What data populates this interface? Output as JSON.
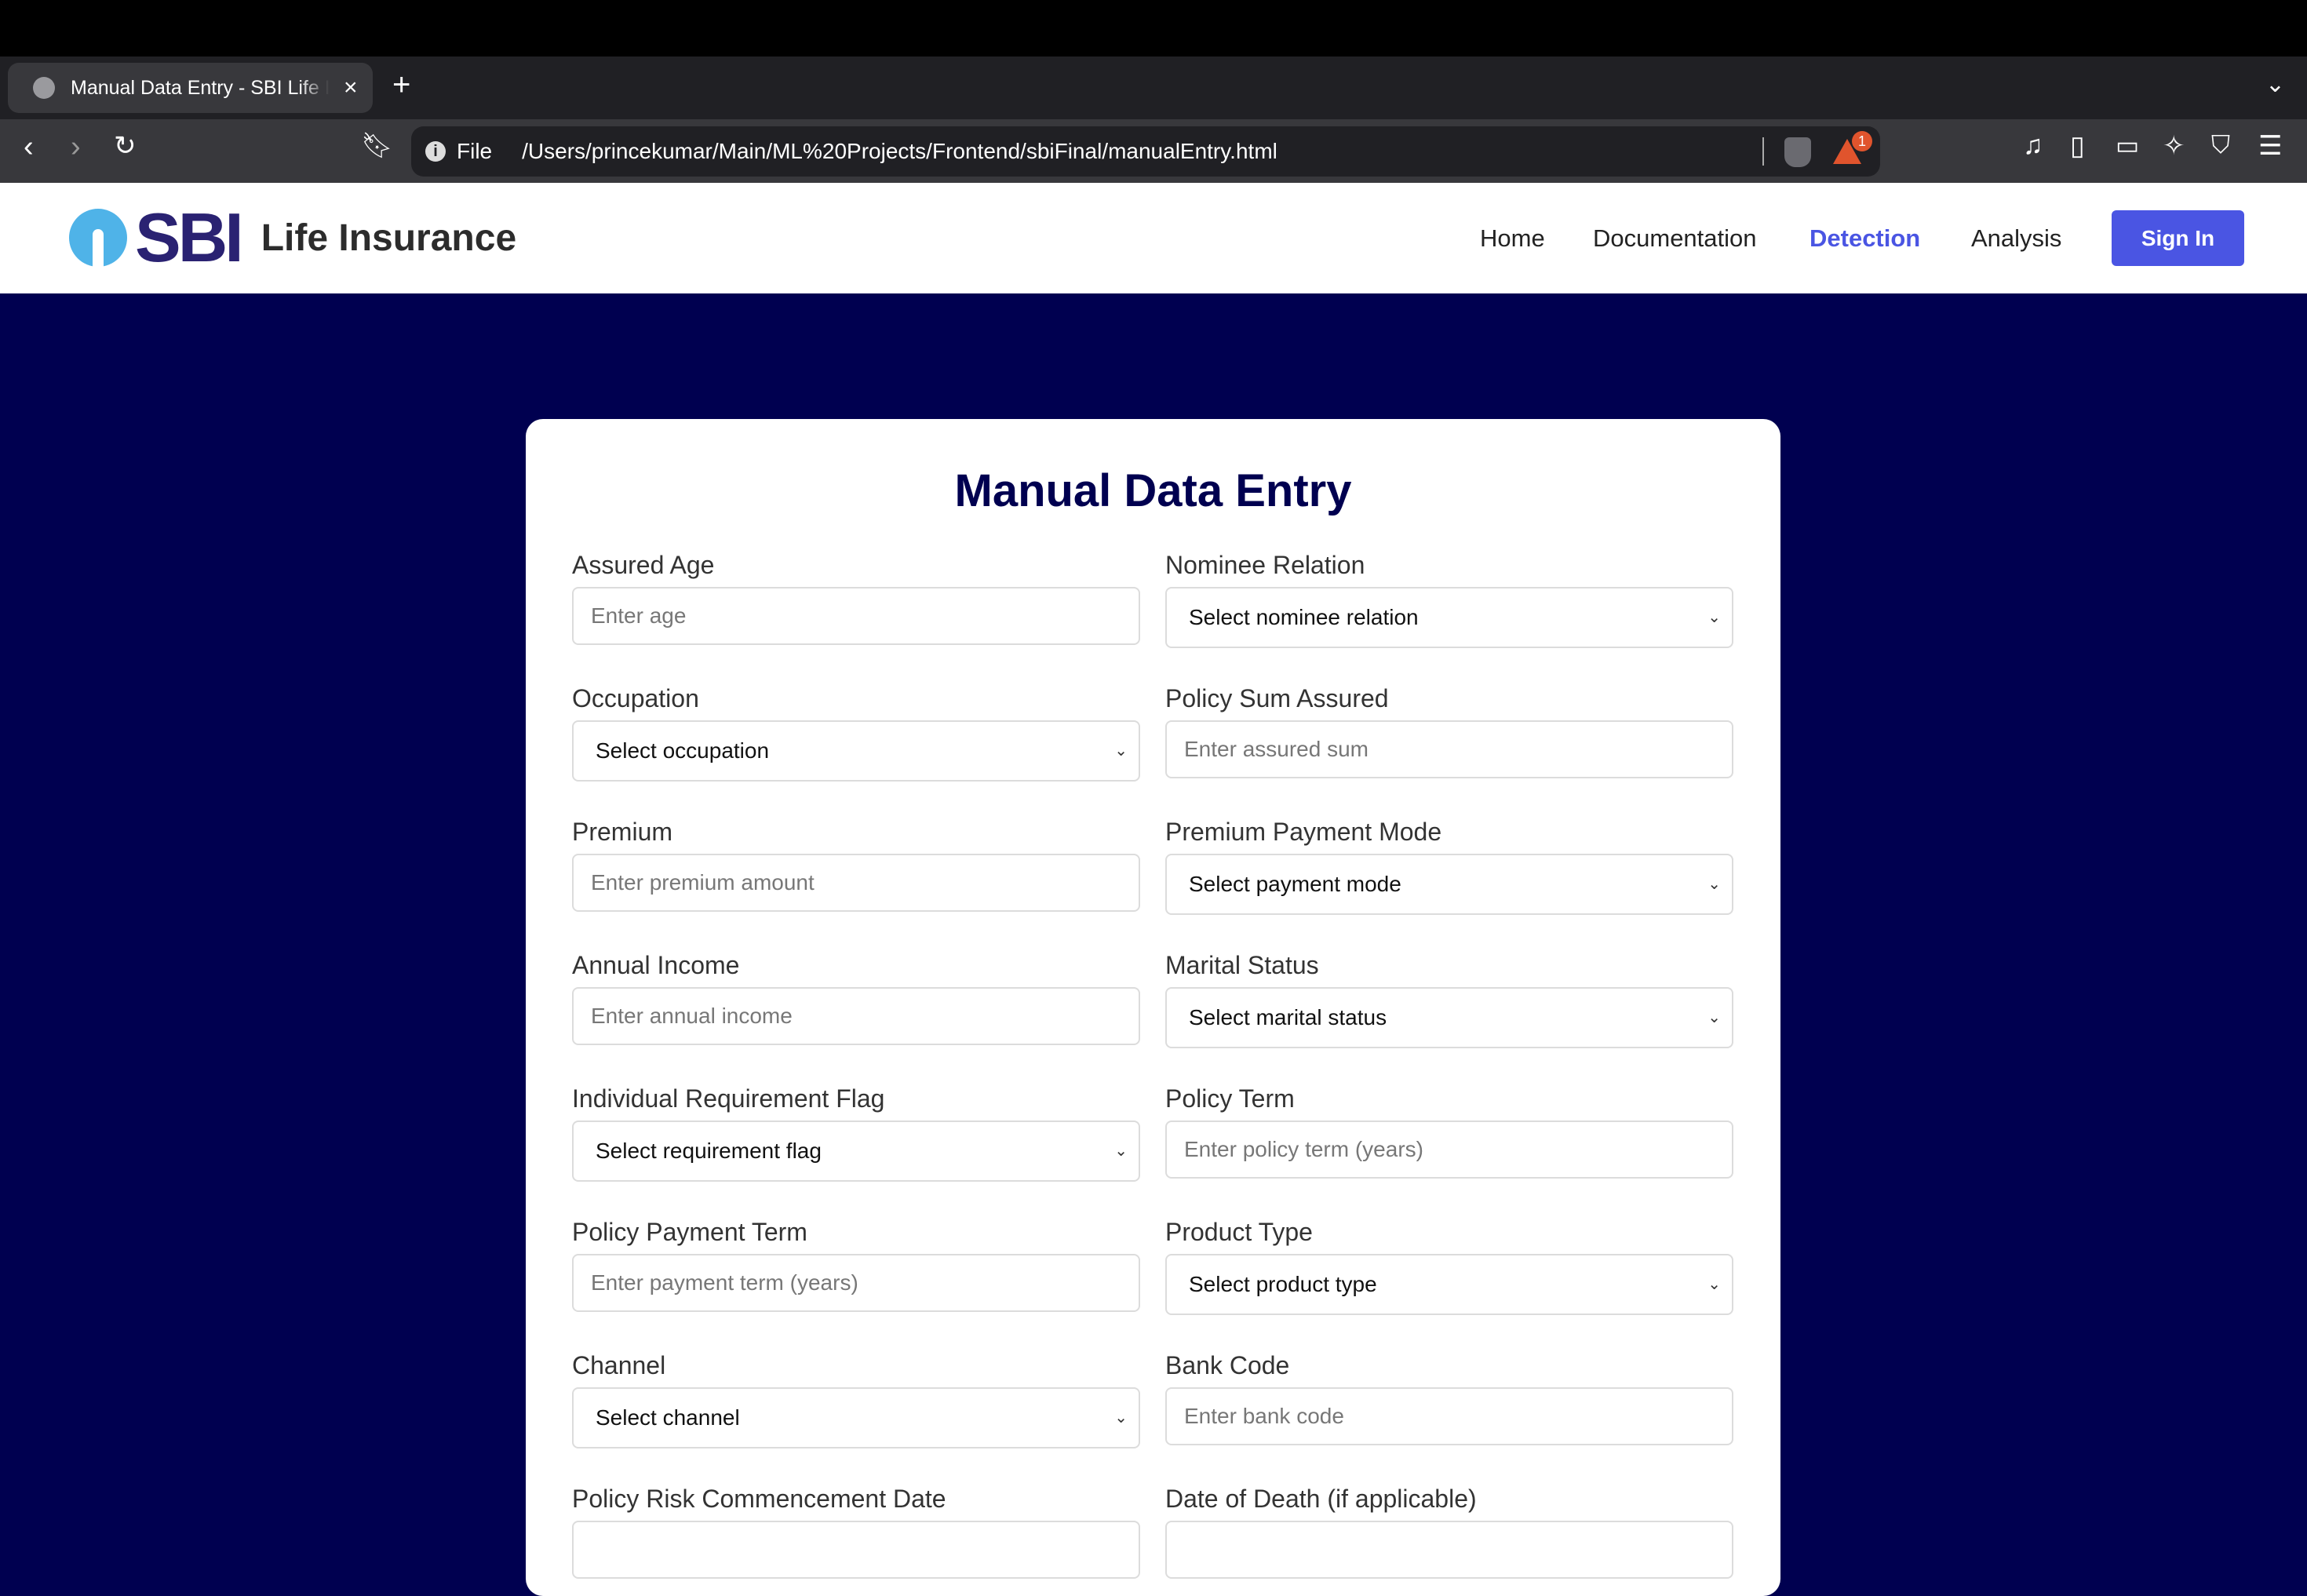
{
  "browser": {
    "tab_title": "Manual Data Entry - SBI Life Insurance",
    "url_scheme": "File",
    "url": "/Users/princekumar/Main/ML%20Projects/Frontend/sbiFinal/manualEntry.html",
    "notification_count": "1"
  },
  "header": {
    "logo_text": "SBI",
    "brand": "Life Insurance",
    "nav": [
      {
        "label": "Home"
      },
      {
        "label": "Documentation"
      },
      {
        "label": "Detection",
        "active": true
      },
      {
        "label": "Analysis"
      }
    ],
    "signin": "Sign In",
    "accent": "#4a55e3"
  },
  "form": {
    "title": "Manual Data Entry",
    "fields": [
      {
        "label": "Assured Age",
        "type": "input",
        "text": "Enter age"
      },
      {
        "label": "Nominee Relation",
        "type": "select",
        "text": "Select nominee relation"
      },
      {
        "label": "Occupation",
        "type": "select",
        "text": "Select occupation"
      },
      {
        "label": "Policy Sum Assured",
        "type": "input",
        "text": "Enter assured sum"
      },
      {
        "label": "Premium",
        "type": "input",
        "text": "Enter premium amount"
      },
      {
        "label": "Premium Payment Mode",
        "type": "select",
        "text": "Select payment mode"
      },
      {
        "label": "Annual Income",
        "type": "input",
        "text": "Enter annual income"
      },
      {
        "label": "Marital Status",
        "type": "select",
        "text": "Select marital status"
      },
      {
        "label": "Individual Requirement Flag",
        "type": "select",
        "text": "Select requirement flag"
      },
      {
        "label": "Policy Term",
        "type": "input",
        "text": "Enter policy term (years)"
      },
      {
        "label": "Policy Payment Term",
        "type": "input",
        "text": "Enter payment term (years)"
      },
      {
        "label": "Product Type",
        "type": "select",
        "text": "Select product type"
      },
      {
        "label": "Channel",
        "type": "select",
        "text": "Select channel"
      },
      {
        "label": "Bank Code",
        "type": "input",
        "text": "Enter bank code"
      },
      {
        "label": "Policy Risk Commencement Date",
        "type": "input",
        "text": ""
      },
      {
        "label": "Date of Death (if applicable)",
        "type": "input",
        "text": ""
      }
    ]
  }
}
